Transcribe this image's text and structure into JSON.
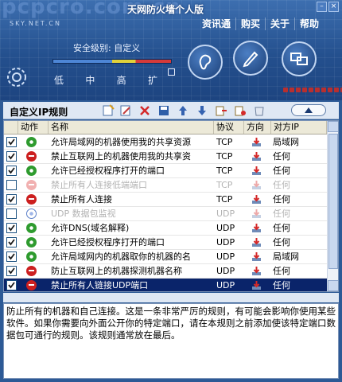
{
  "watermark": "pcpcro.com.cn",
  "app_title": "天网防火墙个人版",
  "logo_text": "SKY.NET.CN",
  "top_menu": [
    {
      "label": "资讯通"
    },
    {
      "label": "购买"
    },
    {
      "label": "关于"
    },
    {
      "label": "帮助"
    }
  ],
  "security": {
    "label": "安全级别: 自定义",
    "levels": [
      "低",
      "中",
      "高",
      "扩"
    ]
  },
  "rules_title": "自定义IP规则",
  "columns": {
    "action": "动作",
    "name": "名称",
    "protocol": "协议",
    "direction": "方向",
    "remote_ip": "对方IP"
  },
  "rules": [
    {
      "checked": true,
      "action": "allow",
      "name": "允许局域网的机器使用我的共享资源",
      "protocol": "TCP",
      "remote_ip": "局域网",
      "enabled": true,
      "selected": false
    },
    {
      "checked": true,
      "action": "block",
      "name": "禁止互联网上的机器使用我的共享资",
      "protocol": "TCP",
      "remote_ip": "任何",
      "enabled": true,
      "selected": false
    },
    {
      "checked": true,
      "action": "allow",
      "name": "允许已经授权程序打开的端口",
      "protocol": "TCP",
      "remote_ip": "任何",
      "enabled": true,
      "selected": false
    },
    {
      "checked": false,
      "action": "block",
      "name": "禁止所有人连接低端端口",
      "protocol": "TCP",
      "remote_ip": "任何",
      "enabled": false,
      "selected": false
    },
    {
      "checked": true,
      "action": "block",
      "name": "禁止所有人连接",
      "protocol": "TCP",
      "remote_ip": "任何",
      "enabled": true,
      "selected": false
    },
    {
      "checked": false,
      "action": "allow",
      "name": "UDP 数据包监视",
      "protocol": "UDP",
      "remote_ip": "任何",
      "enabled": false,
      "selected": false
    },
    {
      "checked": true,
      "action": "allow",
      "name": "允许DNS(域名解释)",
      "protocol": "UDP",
      "remote_ip": "任何",
      "enabled": true,
      "selected": false
    },
    {
      "checked": true,
      "action": "allow",
      "name": "允许已经授权程序打开的端口",
      "protocol": "UDP",
      "remote_ip": "任何",
      "enabled": true,
      "selected": false
    },
    {
      "checked": true,
      "action": "allow",
      "name": "允许局域网内的机器取你的机器的名",
      "protocol": "UDP",
      "remote_ip": "局域网",
      "enabled": true,
      "selected": false
    },
    {
      "checked": true,
      "action": "block",
      "name": "防止互联网上的机器探测机器名称",
      "protocol": "UDP",
      "remote_ip": "任何",
      "enabled": true,
      "selected": false
    },
    {
      "checked": true,
      "action": "block",
      "name": "禁止所有人链接UDP端口",
      "protocol": "UDP",
      "remote_ip": "任何",
      "enabled": true,
      "selected": true
    }
  ],
  "description": "防止所有的机器和自己连接。这是一条非常严厉的规则，有可能会影响你使用某些软件。如果你需要向外面公开你的特定端口，请在本规则之前添加使该特定端口数据包可通行的规则。该规则通常放在最后。",
  "colors": {
    "header_bg": "#24508e",
    "selected_row": "#0a246a",
    "allow": "#2e9b2e",
    "block": "#cc1f1f"
  }
}
